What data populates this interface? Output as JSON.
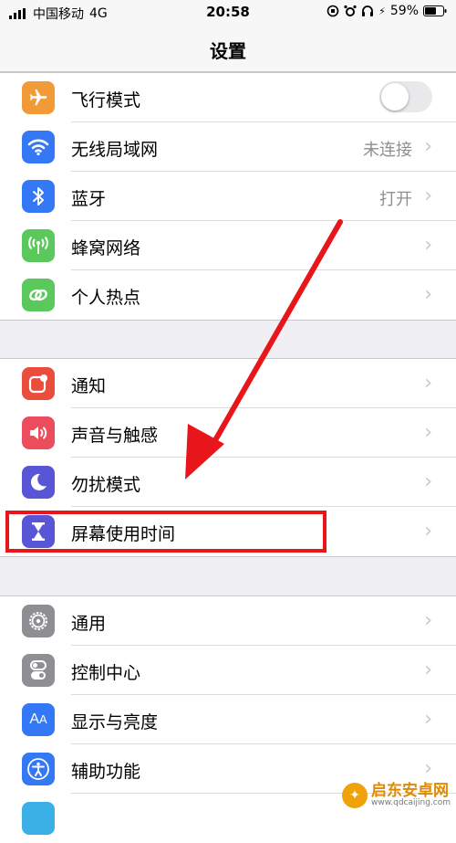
{
  "status_bar": {
    "carrier": "中国移动",
    "network": "4G",
    "time": "20:58",
    "battery": "59%"
  },
  "nav": {
    "title": "设置"
  },
  "groups": [
    {
      "items": [
        {
          "label": "飞行模式",
          "icon": "airplane-icon",
          "color": "#f19a37",
          "control": "toggle",
          "toggle_on": false
        },
        {
          "label": "无线局域网",
          "icon": "wifi-icon",
          "color": "#3478f6",
          "value": "未连接"
        },
        {
          "label": "蓝牙",
          "icon": "bluetooth-icon",
          "color": "#3478f6",
          "value": "打开"
        },
        {
          "label": "蜂窝网络",
          "icon": "cellular-icon",
          "color": "#5ac85a"
        },
        {
          "label": "个人热点",
          "icon": "hotspot-icon",
          "color": "#5ac85a"
        }
      ]
    },
    {
      "items": [
        {
          "label": "通知",
          "icon": "notifications-icon",
          "color": "#eb4d3d"
        },
        {
          "label": "声音与触感",
          "icon": "sound-icon",
          "color": "#eb4d5c"
        },
        {
          "label": "勿扰模式",
          "icon": "moon-icon",
          "color": "#5856d6"
        },
        {
          "label": "屏幕使用时间",
          "icon": "hourglass-icon",
          "color": "#5856d6"
        }
      ]
    },
    {
      "items": [
        {
          "label": "通用",
          "icon": "gear-icon",
          "color": "#8e8e93"
        },
        {
          "label": "控制中心",
          "icon": "switches-icon",
          "color": "#8e8e93"
        },
        {
          "label": "显示与亮度",
          "icon": "text-size-icon",
          "color": "#3478f6"
        },
        {
          "label": "辅助功能",
          "icon": "accessibility-icon",
          "color": "#3478f6"
        }
      ]
    }
  ],
  "annotation": {
    "color": "#e8151a"
  },
  "watermark": {
    "title": "启东安卓网",
    "url": "www.qdcaijing.com"
  }
}
